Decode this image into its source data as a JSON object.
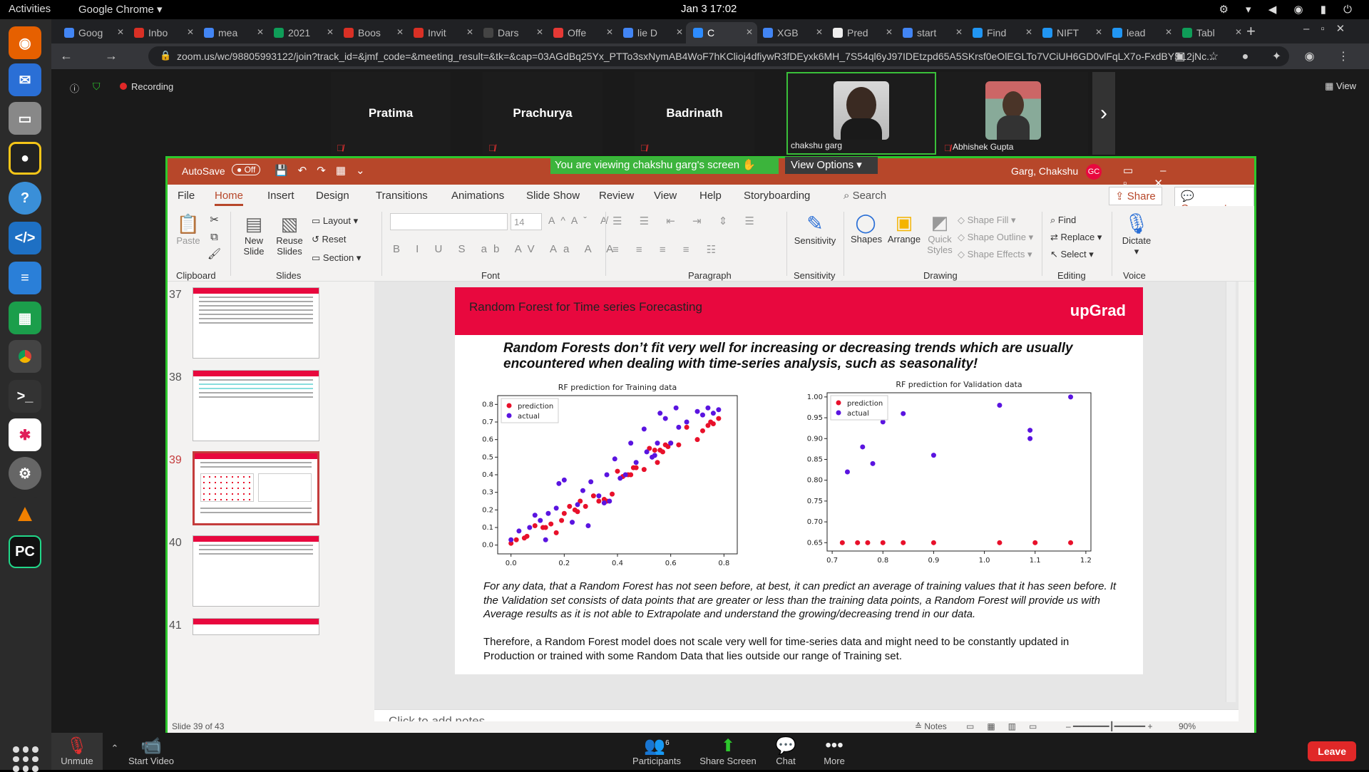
{
  "system": {
    "activities": "Activities",
    "app": "Google Chrome ▾",
    "clock": "Jan 3  17:02"
  },
  "tabs": [
    {
      "label": "Goog",
      "color": "#4285f4"
    },
    {
      "label": "Inbo",
      "color": "#d93025"
    },
    {
      "label": "mea",
      "color": "#4285f4"
    },
    {
      "label": "2021",
      "color": "#0f9d58"
    },
    {
      "label": "Boos",
      "color": "#d93025"
    },
    {
      "label": "Invit",
      "color": "#d93025"
    },
    {
      "label": "Dars",
      "color": "#444"
    },
    {
      "label": "Offe",
      "color": "#e53935"
    },
    {
      "label": "lie D",
      "color": "#4285f4"
    },
    {
      "label": "C",
      "color": "#2d8cff"
    },
    {
      "label": "XGB",
      "color": "#4285f4"
    },
    {
      "label": "Pred",
      "color": "#eee"
    },
    {
      "label": "start",
      "color": "#4285f4"
    },
    {
      "label": "Find",
      "color": "#2196f3"
    },
    {
      "label": "NIFT",
      "color": "#2196f3"
    },
    {
      "label": "lead",
      "color": "#2196f3"
    },
    {
      "label": "Tabl",
      "color": "#0f9d58"
    }
  ],
  "url": "zoom.us/wc/98805993122/join?track_id=&jmf_code=&meeting_result=&tk=&cap=03AGdBq25Yx_PTTo3sxNymAB4WoF7hKClioj4dfiywR3fDEyxk6MH_7S54ql6yJ97IDEtzpd65A5SKrsf0eOlEGLTo7VCiUH6GD0vlFqLX7o-FxdBYS12jNc...",
  "zoom": {
    "recording": "Recording",
    "view": "View",
    "participants": [
      "Pratima",
      "Prachurya",
      "Badrinath"
    ],
    "video_names": [
      "chakshu garg",
      "Abhishek Gupta"
    ],
    "banner": "You are viewing chakshu garg's screen",
    "view_options": "View Options ▾",
    "bottom": {
      "unmute": "Unmute",
      "start_video": "Start Video",
      "participants": "Participants",
      "participants_count": "6",
      "share": "Share Screen",
      "chat": "Chat",
      "more": "More",
      "leave": "Leave"
    }
  },
  "ppt": {
    "autosave": "AutoSave",
    "autosave_state": "Off",
    "user": "Garg, Chakshu",
    "user_initials": "GC",
    "menu": [
      "File",
      "Home",
      "Insert",
      "Design",
      "Transitions",
      "Animations",
      "Slide Show",
      "Review",
      "View",
      "Help",
      "Storyboarding"
    ],
    "search": "Search",
    "share": "Share",
    "comments": "Comments",
    "ribbon": {
      "paste": "Paste",
      "new_slide": "New\nSlide",
      "reuse": "Reuse\nSlides",
      "layout": "Layout",
      "reset": "Reset",
      "section": "Section",
      "font_size": "14",
      "sensitivity": "Sensitivity",
      "shapes": "Shapes",
      "arrange": "Arrange",
      "quick_styles": "Quick\nStyles",
      "shape_fill": "Shape Fill",
      "shape_outline": "Shape Outline",
      "shape_effects": "Shape Effects",
      "find": "Find",
      "replace": "Replace",
      "select": "Select",
      "dictate": "Dictate",
      "groups": [
        "Clipboard",
        "Slides",
        "Font",
        "Paragraph",
        "Sensitivity",
        "Drawing",
        "Editing",
        "Voice"
      ]
    },
    "slide_numbers": [
      "37",
      "38",
      "39",
      "40",
      "41"
    ],
    "slide": {
      "title": "Random Forest for Time series Forecasting",
      "logo": "upGrad",
      "headline": "Random Forests don’t fit very well for increasing or decreasing trends which are usually encountered when dealing with time-series analysis, such as seasonality!",
      "para1": "For any data, that a Random Forest has not seen before, at best, it can predict an average of training values that it has seen before. It the Validation set consists of data points that are greater or less than the training data points, a Random Forest will provide us with Average results as it is not able to Extrapolate and understand the growing/decreasing trend in our data.",
      "para2": "Therefore, a Random Forest model does not scale very well for time-series data and might need to be constantly updated in Production or trained with some Random Data that lies outside our range of Training set."
    },
    "notes": "Click to add notes",
    "status": {
      "slide": "Slide 39 of 43",
      "notes": "Notes",
      "zoom": "90%"
    }
  },
  "chart_data": [
    {
      "type": "scatter",
      "title": "RF prediction for Training data",
      "xlim": [
        -0.05,
        0.85
      ],
      "ylim": [
        -0.05,
        0.85
      ],
      "xticks": [
        "0.0",
        "0.2",
        "0.4",
        "0.6",
        "0.8"
      ],
      "yticks": [
        "0.0",
        "0.1",
        "0.2",
        "0.3",
        "0.4",
        "0.5",
        "0.6",
        "0.7",
        "0.8"
      ],
      "legend": "top-left",
      "grid": false,
      "series": [
        {
          "name": "prediction",
          "color": "#e8102a",
          "x": [
            0.0,
            0.02,
            0.05,
            0.06,
            0.09,
            0.12,
            0.13,
            0.15,
            0.17,
            0.19,
            0.2,
            0.22,
            0.24,
            0.25,
            0.26,
            0.28,
            0.31,
            0.33,
            0.35,
            0.36,
            0.38,
            0.4,
            0.42,
            0.44,
            0.45,
            0.46,
            0.47,
            0.5,
            0.52,
            0.54,
            0.55,
            0.56,
            0.57,
            0.58,
            0.59,
            0.6,
            0.63,
            0.66,
            0.7,
            0.72,
            0.74,
            0.75,
            0.76,
            0.78
          ],
          "y": [
            0.01,
            0.03,
            0.04,
            0.05,
            0.11,
            0.1,
            0.1,
            0.12,
            0.07,
            0.14,
            0.18,
            0.22,
            0.2,
            0.19,
            0.25,
            0.22,
            0.28,
            0.25,
            0.26,
            0.25,
            0.29,
            0.42,
            0.39,
            0.4,
            0.4,
            0.44,
            0.44,
            0.43,
            0.55,
            0.54,
            0.47,
            0.54,
            0.53,
            0.57,
            0.56,
            0.58,
            0.57,
            0.67,
            0.6,
            0.65,
            0.68,
            0.7,
            0.69,
            0.72
          ]
        },
        {
          "name": "actual",
          "color": "#5a14e0",
          "x": [
            0.0,
            0.03,
            0.07,
            0.09,
            0.11,
            0.13,
            0.14,
            0.17,
            0.18,
            0.2,
            0.23,
            0.25,
            0.27,
            0.29,
            0.3,
            0.33,
            0.35,
            0.36,
            0.37,
            0.39,
            0.41,
            0.43,
            0.45,
            0.47,
            0.5,
            0.51,
            0.53,
            0.54,
            0.55,
            0.56,
            0.58,
            0.6,
            0.62,
            0.63,
            0.66,
            0.7,
            0.72,
            0.74,
            0.76,
            0.78
          ],
          "y": [
            0.03,
            0.08,
            0.1,
            0.17,
            0.14,
            0.03,
            0.18,
            0.21,
            0.35,
            0.37,
            0.13,
            0.23,
            0.31,
            0.11,
            0.36,
            0.28,
            0.24,
            0.4,
            0.25,
            0.49,
            0.38,
            0.4,
            0.58,
            0.47,
            0.66,
            0.53,
            0.5,
            0.51,
            0.58,
            0.75,
            0.72,
            0.58,
            0.78,
            0.67,
            0.7,
            0.76,
            0.74,
            0.78,
            0.75,
            0.77
          ]
        }
      ]
    },
    {
      "type": "scatter",
      "title": "RF prediction for Validation data",
      "xlim": [
        0.69,
        1.21
      ],
      "ylim": [
        0.63,
        1.01
      ],
      "xticks": [
        "0.7",
        "0.8",
        "0.9",
        "1.0",
        "1.1",
        "1.2"
      ],
      "yticks": [
        "0.65",
        "0.70",
        "0.75",
        "0.80",
        "0.85",
        "0.90",
        "0.95",
        "1.00"
      ],
      "legend": "top-left",
      "grid": false,
      "series": [
        {
          "name": "prediction",
          "color": "#e8102a",
          "x": [
            0.72,
            0.75,
            0.77,
            0.8,
            0.84,
            0.9,
            1.03,
            1.1,
            1.17
          ],
          "y": [
            0.65,
            0.65,
            0.65,
            0.65,
            0.65,
            0.65,
            0.65,
            0.65,
            0.65
          ]
        },
        {
          "name": "actual",
          "color": "#5a14e0",
          "x": [
            0.73,
            0.76,
            0.78,
            0.8,
            0.84,
            0.9,
            1.03,
            1.09,
            1.09,
            1.17
          ],
          "y": [
            0.82,
            0.88,
            0.84,
            0.94,
            0.96,
            0.86,
            0.98,
            0.92,
            0.9,
            1.0
          ]
        }
      ]
    }
  ]
}
